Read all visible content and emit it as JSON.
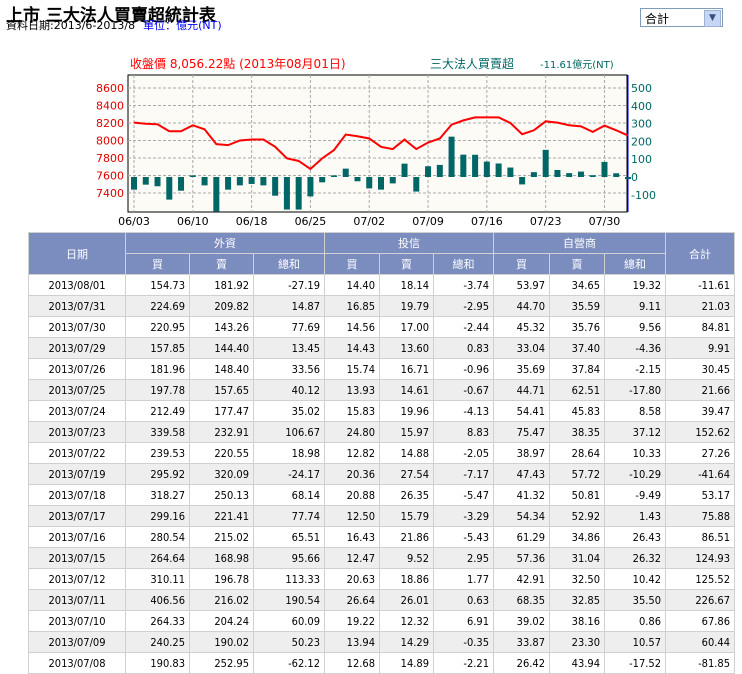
{
  "header": {
    "title": "上市 三大法人買賣超統計表",
    "date_range": "資料日期:2013/6-2013/8",
    "unit": "單位：億元(NT)"
  },
  "select": {
    "value": "合計"
  },
  "chart_data": {
    "type": "bar+line",
    "left_title": "收盤價 8,056.22點 (2013年08月01日)",
    "right_title": "三大法人買賣超",
    "right_value": "-11.61億元(NT)",
    "colors": {
      "line": "#ff0000",
      "bar": "#006666",
      "background": "#fdfbf5"
    },
    "grid": true,
    "left_axis": {
      "ticks": [
        8600,
        8400,
        8200,
        8000,
        7800,
        7600,
        7400
      ]
    },
    "right_axis": {
      "ticks": [
        500,
        400,
        300,
        200,
        100,
        0,
        -100
      ]
    },
    "x_ticks": [
      "06/03",
      "06/10",
      "06/18",
      "06/25",
      "07/02",
      "07/09",
      "07/16",
      "07/23",
      "07/30"
    ],
    "dates": [
      "06/03",
      "06/04",
      "06/05",
      "06/06",
      "06/07",
      "06/10",
      "06/11",
      "06/13",
      "06/14",
      "06/17",
      "06/18",
      "06/19",
      "06/20",
      "06/21",
      "06/24",
      "06/25",
      "06/26",
      "06/27",
      "06/28",
      "07/01",
      "07/02",
      "07/03",
      "07/04",
      "07/05",
      "07/08",
      "07/09",
      "07/10",
      "07/11",
      "07/12",
      "07/15",
      "07/16",
      "07/17",
      "07/18",
      "07/19",
      "07/22",
      "07/23",
      "07/24",
      "07/25",
      "07/26",
      "07/29",
      "07/30",
      "07/31",
      "08/01"
    ],
    "close": [
      8204,
      8192,
      8185,
      8106,
      8106,
      8174,
      8128,
      7958,
      7947,
      8000,
      8011,
      8011,
      7928,
      7796,
      7766,
      7675,
      7796,
      7890,
      8068,
      8049,
      8023,
      7928,
      7902,
      8011,
      7902,
      7977,
      8023,
      8181,
      8230,
      8264,
      8264,
      8264,
      8200,
      8072,
      8117,
      8219,
      8204,
      8174,
      8162,
      8098,
      8170,
      8117,
      8056.22
    ],
    "net": [
      -71,
      -43,
      -52,
      -127,
      -77,
      9,
      -47,
      -193,
      -71,
      -47,
      -39,
      -47,
      -105,
      -183,
      -183,
      -109,
      -30,
      9,
      47,
      -24,
      -64,
      -71,
      -36,
      75,
      -81.85,
      60.44,
      67.86,
      226.67,
      125.52,
      124.93,
      86.51,
      75.88,
      53.17,
      -41.64,
      27.26,
      152.62,
      39.47,
      21.66,
      30.45,
      9.91,
      84.81,
      21.03,
      -11.61
    ]
  },
  "table": {
    "headers": {
      "date": "日期",
      "foreign": "外資",
      "trust": "投信",
      "dealer": "自營商",
      "total": "合計",
      "buy": "買",
      "sell": "賣",
      "net": "總和"
    },
    "rows": [
      [
        "2013/08/01",
        "154.73",
        "181.92",
        "-27.19",
        "14.40",
        "18.14",
        "-3.74",
        "53.97",
        "34.65",
        "19.32",
        "-11.61"
      ],
      [
        "2013/07/31",
        "224.69",
        "209.82",
        "14.87",
        "16.85",
        "19.79",
        "-2.95",
        "44.70",
        "35.59",
        "9.11",
        "21.03"
      ],
      [
        "2013/07/30",
        "220.95",
        "143.26",
        "77.69",
        "14.56",
        "17.00",
        "-2.44",
        "45.32",
        "35.76",
        "9.56",
        "84.81"
      ],
      [
        "2013/07/29",
        "157.85",
        "144.40",
        "13.45",
        "14.43",
        "13.60",
        "0.83",
        "33.04",
        "37.40",
        "-4.36",
        "9.91"
      ],
      [
        "2013/07/26",
        "181.96",
        "148.40",
        "33.56",
        "15.74",
        "16.71",
        "-0.96",
        "35.69",
        "37.84",
        "-2.15",
        "30.45"
      ],
      [
        "2013/07/25",
        "197.78",
        "157.65",
        "40.12",
        "13.93",
        "14.61",
        "-0.67",
        "44.71",
        "62.51",
        "-17.80",
        "21.66"
      ],
      [
        "2013/07/24",
        "212.49",
        "177.47",
        "35.02",
        "15.83",
        "19.96",
        "-4.13",
        "54.41",
        "45.83",
        "8.58",
        "39.47"
      ],
      [
        "2013/07/23",
        "339.58",
        "232.91",
        "106.67",
        "24.80",
        "15.97",
        "8.83",
        "75.47",
        "38.35",
        "37.12",
        "152.62"
      ],
      [
        "2013/07/22",
        "239.53",
        "220.55",
        "18.98",
        "12.82",
        "14.88",
        "-2.05",
        "38.97",
        "28.64",
        "10.33",
        "27.26"
      ],
      [
        "2013/07/19",
        "295.92",
        "320.09",
        "-24.17",
        "20.36",
        "27.54",
        "-7.17",
        "47.43",
        "57.72",
        "-10.29",
        "-41.64"
      ],
      [
        "2013/07/18",
        "318.27",
        "250.13",
        "68.14",
        "20.88",
        "26.35",
        "-5.47",
        "41.32",
        "50.81",
        "-9.49",
        "53.17"
      ],
      [
        "2013/07/17",
        "299.16",
        "221.41",
        "77.74",
        "12.50",
        "15.79",
        "-3.29",
        "54.34",
        "52.92",
        "1.43",
        "75.88"
      ],
      [
        "2013/07/16",
        "280.54",
        "215.02",
        "65.51",
        "16.43",
        "21.86",
        "-5.43",
        "61.29",
        "34.86",
        "26.43",
        "86.51"
      ],
      [
        "2013/07/15",
        "264.64",
        "168.98",
        "95.66",
        "12.47",
        "9.52",
        "2.95",
        "57.36",
        "31.04",
        "26.32",
        "124.93"
      ],
      [
        "2013/07/12",
        "310.11",
        "196.78",
        "113.33",
        "20.63",
        "18.86",
        "1.77",
        "42.91",
        "32.50",
        "10.42",
        "125.52"
      ],
      [
        "2013/07/11",
        "406.56",
        "216.02",
        "190.54",
        "26.64",
        "26.01",
        "0.63",
        "68.35",
        "32.85",
        "35.50",
        "226.67"
      ],
      [
        "2013/07/10",
        "264.33",
        "204.24",
        "60.09",
        "19.22",
        "12.32",
        "6.91",
        "39.02",
        "38.16",
        "0.86",
        "67.86"
      ],
      [
        "2013/07/09",
        "240.25",
        "190.02",
        "50.23",
        "13.94",
        "14.29",
        "-0.35",
        "33.87",
        "23.30",
        "10.57",
        "60.44"
      ],
      [
        "2013/07/08",
        "190.83",
        "252.95",
        "-62.12",
        "12.68",
        "14.89",
        "-2.21",
        "26.42",
        "43.94",
        "-17.52",
        "-81.85"
      ]
    ]
  }
}
